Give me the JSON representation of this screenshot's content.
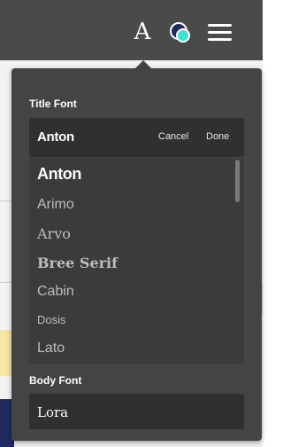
{
  "header": {
    "font_icon_glyph": "A",
    "icons": [
      "font-settings-icon",
      "theme-color-icon",
      "hamburger-menu-icon"
    ]
  },
  "title_font": {
    "label": "Title Font",
    "current": "Anton",
    "cancel_label": "Cancel",
    "done_label": "Done",
    "options": [
      "Anton",
      "Arimo",
      "Arvo",
      "Bree Serif",
      "Cabin",
      "Dosis",
      "Lato"
    ]
  },
  "body_font": {
    "label": "Body Font",
    "current": "Lora"
  },
  "colors": {
    "popover_bg": "#444444",
    "list_bg": "#3b3b3b",
    "selector_bg": "#303030",
    "theme_dot_primary": "#1f2a5e",
    "theme_dot_accent": "#3fe0d0"
  }
}
